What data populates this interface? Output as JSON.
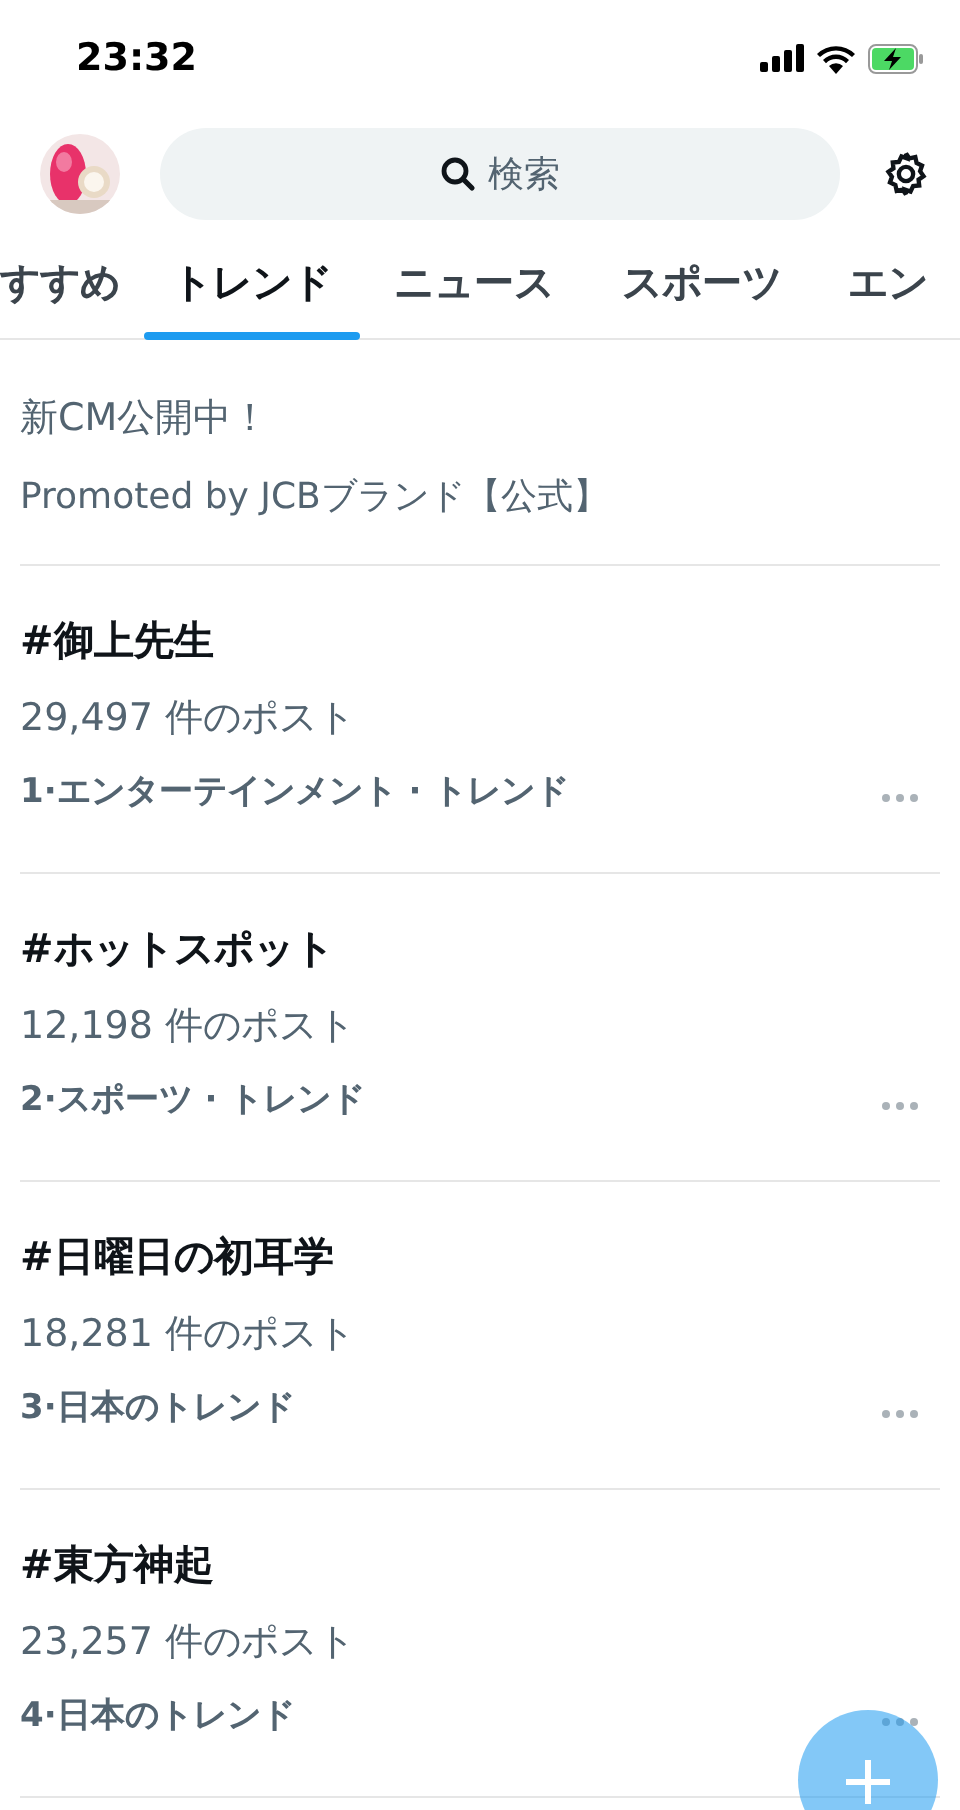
{
  "status_bar": {
    "time": "23:32"
  },
  "search": {
    "placeholder": "検索"
  },
  "tabs": [
    {
      "label": "すすめ",
      "selected": false
    },
    {
      "label": "トレンド",
      "selected": true
    },
    {
      "label": "ニュース",
      "selected": false
    },
    {
      "label": "スポーツ",
      "selected": false
    },
    {
      "label": "エン",
      "selected": false
    }
  ],
  "promoted": {
    "description": "新CM公開中！",
    "sponsor": "Promoted by JCBブランド【公式】"
  },
  "trends": [
    {
      "title": "#御上先生",
      "posts": "29,497 件のポスト",
      "meta": "1·エンターテインメント · トレンド"
    },
    {
      "title": "#ホットスポット",
      "posts": "12,198 件のポスト",
      "meta": "2·スポーツ · トレンド"
    },
    {
      "title": "#日曜日の初耳学",
      "posts": "18,281 件のポスト",
      "meta": "3·日本のトレンド"
    },
    {
      "title": "#東方神起",
      "posts": "23,257 件のポスト",
      "meta": "4·日本のトレンド"
    }
  ]
}
